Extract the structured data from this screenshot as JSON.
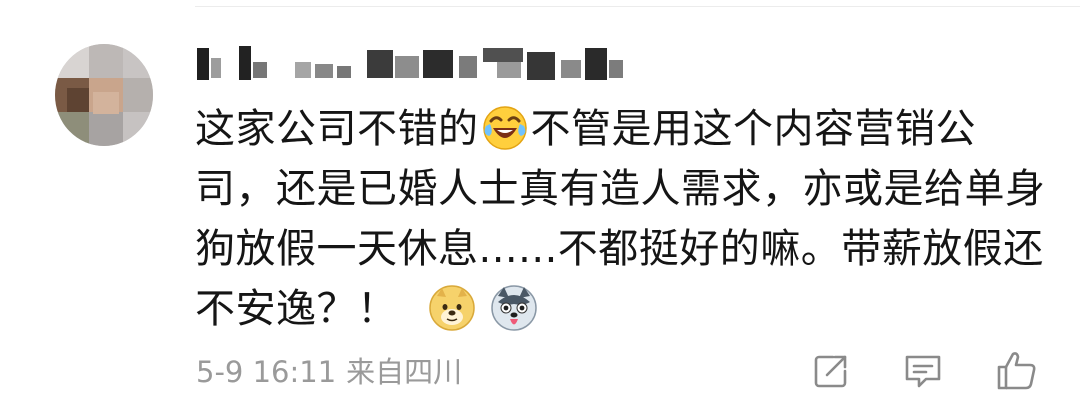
{
  "comment": {
    "username": "",
    "text_part1": "这家公司不错的",
    "emoji_inline": "laughing-crying-icon",
    "text_part2": "不管是用这个内容营销公司，还是已婚人士真有造人需求，亦或是给单身狗放假一天休息......不都挺好的嘛。带薪放假还不安逸？！",
    "trailing_emojis": [
      "doge-icon",
      "husky-tongue-icon"
    ],
    "date_time": "5-9 16:11",
    "source": "来自四川"
  },
  "actions": [
    {
      "name": "repost",
      "icon": "share-icon"
    },
    {
      "name": "comment",
      "icon": "comment-icon"
    },
    {
      "name": "like",
      "icon": "thumbs-up-icon"
    }
  ],
  "colors": {
    "text": "#151515",
    "meta": "#9a9a9a",
    "icon": "#8a8a8a"
  }
}
